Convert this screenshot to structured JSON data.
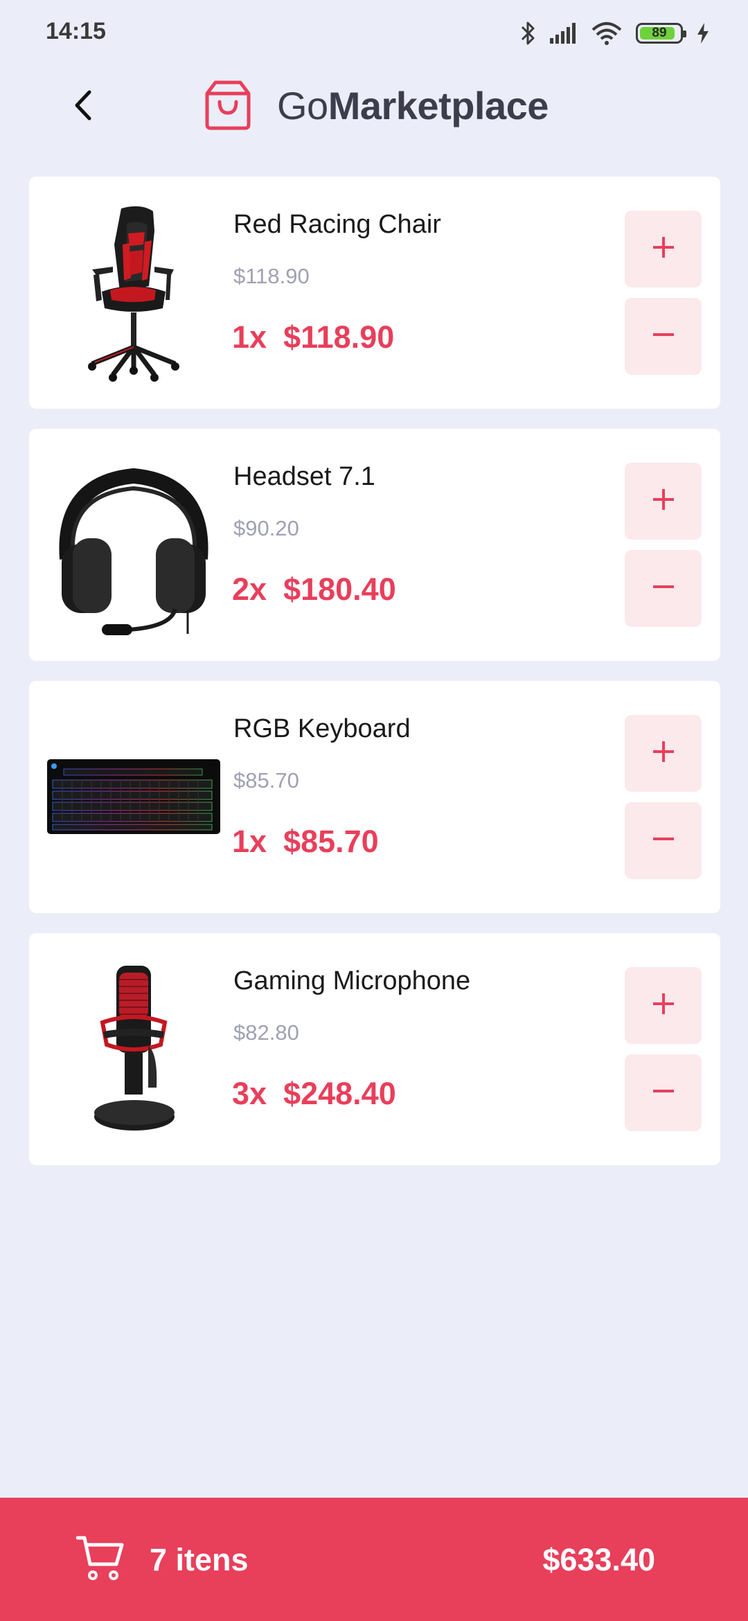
{
  "status_bar": {
    "time": "14:15",
    "battery_level": "89",
    "battery_fraction": 0.89,
    "icons": [
      "bluetooth-icon",
      "signal-icon",
      "wifi-icon",
      "battery-icon",
      "charging-icon"
    ]
  },
  "header": {
    "back_icon": "chevron-left-icon",
    "logo_icon": "shopping-bag-icon",
    "logo_light": "Go",
    "logo_bold": "Marketplace"
  },
  "products": [
    {
      "title": "Red Racing Chair",
      "price": "$118.90",
      "quantity": "1x",
      "subtotal": "$118.90",
      "image": "racing-chair"
    },
    {
      "title": "Headset 7.1",
      "price": "$90.20",
      "quantity": "2x",
      "subtotal": "$180.40",
      "image": "headset"
    },
    {
      "title": "RGB Keyboard",
      "price": "$85.70",
      "quantity": "1x",
      "subtotal": "$85.70",
      "image": "rgb-keyboard"
    },
    {
      "title": "Gaming Microphone",
      "price": "$82.80",
      "quantity": "3x",
      "subtotal": "$248.40",
      "image": "microphone"
    }
  ],
  "footer": {
    "cart_icon": "shopping-cart-icon",
    "item_count": "7 itens",
    "total": "$633.40"
  },
  "colors": {
    "background": "#EBEEF8",
    "accent": "#E83F5B",
    "button_bg": "#FCE9EC",
    "muted_text": "#A0A0B3",
    "title_text": "#3D3D4D"
  }
}
